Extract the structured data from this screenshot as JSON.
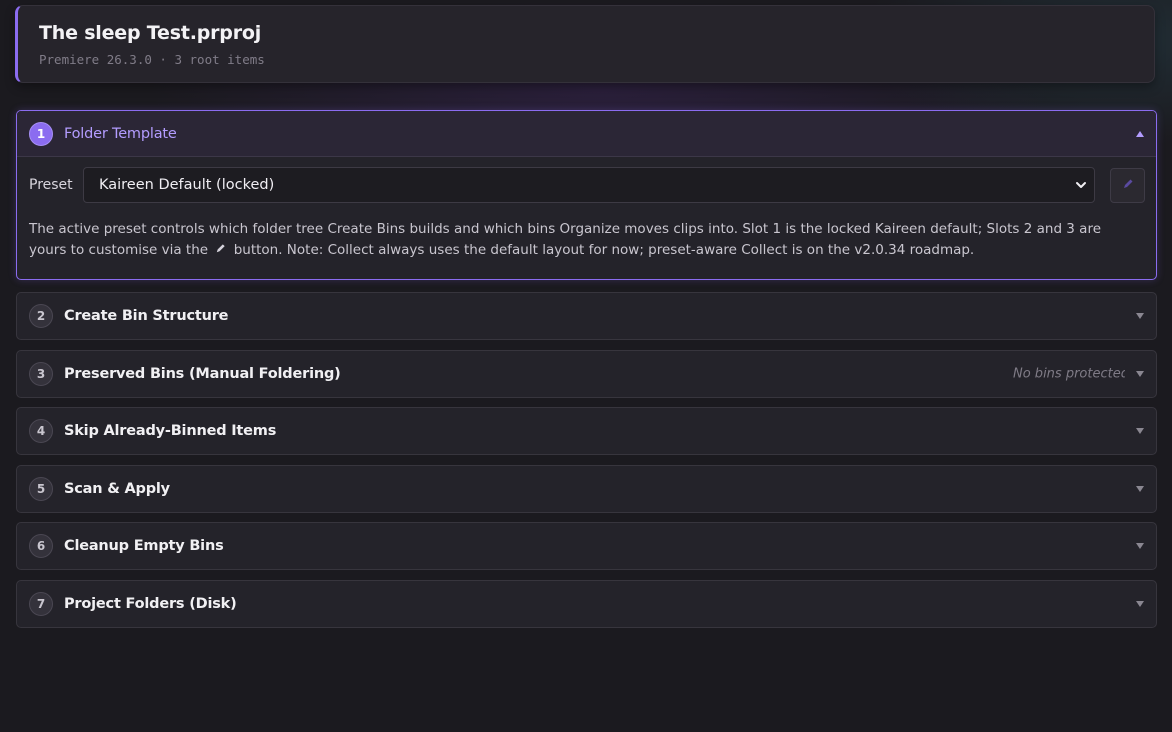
{
  "project": {
    "title": "The sleep Test.prproj",
    "subtitle": "Premiere 26.3.0 · 3 root items"
  },
  "colors": {
    "accent": "#8b6cf0",
    "accent_text": "#b39cff",
    "background": "#1b1a1f",
    "panel": "#24232a"
  },
  "panels": [
    {
      "number": "1",
      "title": "Folder Template",
      "expanded": true,
      "preset_label": "Preset",
      "preset_value": "Kaireen Default (locked)",
      "edit_icon": "pencil-icon",
      "description_part1": "The active preset controls which folder tree Create Bins builds and which bins Organize moves clips into. Slot 1 is the locked Kaireen default; Slots 2 and 3 are yours to customise via the",
      "description_part2": "button. Note: Collect always uses the default layout for now; preset-aware Collect is on the v2.0.34 roadmap."
    },
    {
      "number": "2",
      "title": "Create Bin Structure",
      "expanded": false
    },
    {
      "number": "3",
      "title": "Preserved Bins (Manual Foldering)",
      "expanded": false,
      "meta": "No bins protected"
    },
    {
      "number": "4",
      "title": "Skip Already-Binned Items",
      "expanded": false
    },
    {
      "number": "5",
      "title": "Scan & Apply",
      "expanded": false
    },
    {
      "number": "6",
      "title": "Cleanup Empty Bins",
      "expanded": false
    },
    {
      "number": "7",
      "title": "Project Folders (Disk)",
      "expanded": false
    }
  ]
}
